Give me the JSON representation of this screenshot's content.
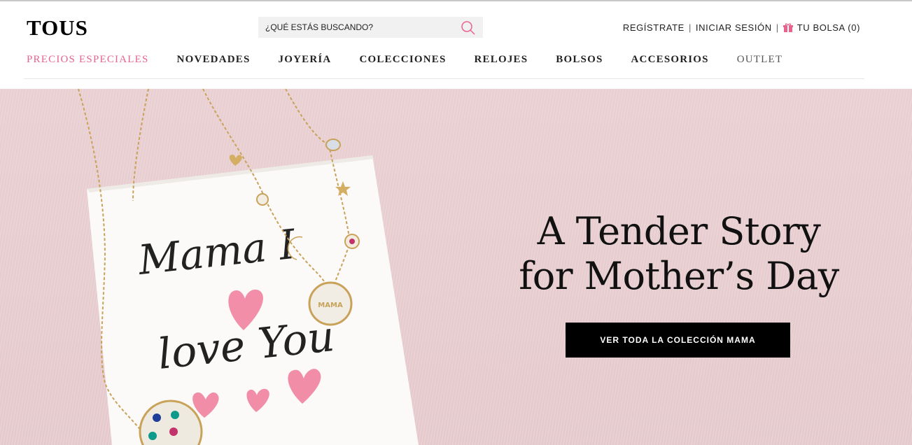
{
  "brand": {
    "logo_text": "TOUS"
  },
  "search": {
    "placeholder": "¿QUÉ ESTÁS BUSCANDO?",
    "icon": "search-icon"
  },
  "account": {
    "register": "REGÍSTRATE",
    "login": "INICIAR SESIÓN",
    "bag": "TU BOLSA (0)",
    "separator": "|",
    "bag_icon": "gift-icon",
    "accent_color": "#e8638e"
  },
  "nav": {
    "items": [
      {
        "label": "PRECIOS ESPECIALES"
      },
      {
        "label": "NOVEDADES"
      },
      {
        "label": "JOYERÍA"
      },
      {
        "label": "COLECCIONES"
      },
      {
        "label": "RELOJES"
      },
      {
        "label": "BOLSOS"
      },
      {
        "label": "ACCESORIOS"
      },
      {
        "label": "OUTLET"
      }
    ]
  },
  "hero": {
    "note_text_line1": "Mama I",
    "note_text_line2": "love You",
    "title_line1": "A Tender Story",
    "title_line2": "for Mother’s Day",
    "cta_label": "VER TODA LA COLECCIÓN MAMA",
    "background_color": "#ebd2d4",
    "heart_color": "#f07a9a"
  }
}
